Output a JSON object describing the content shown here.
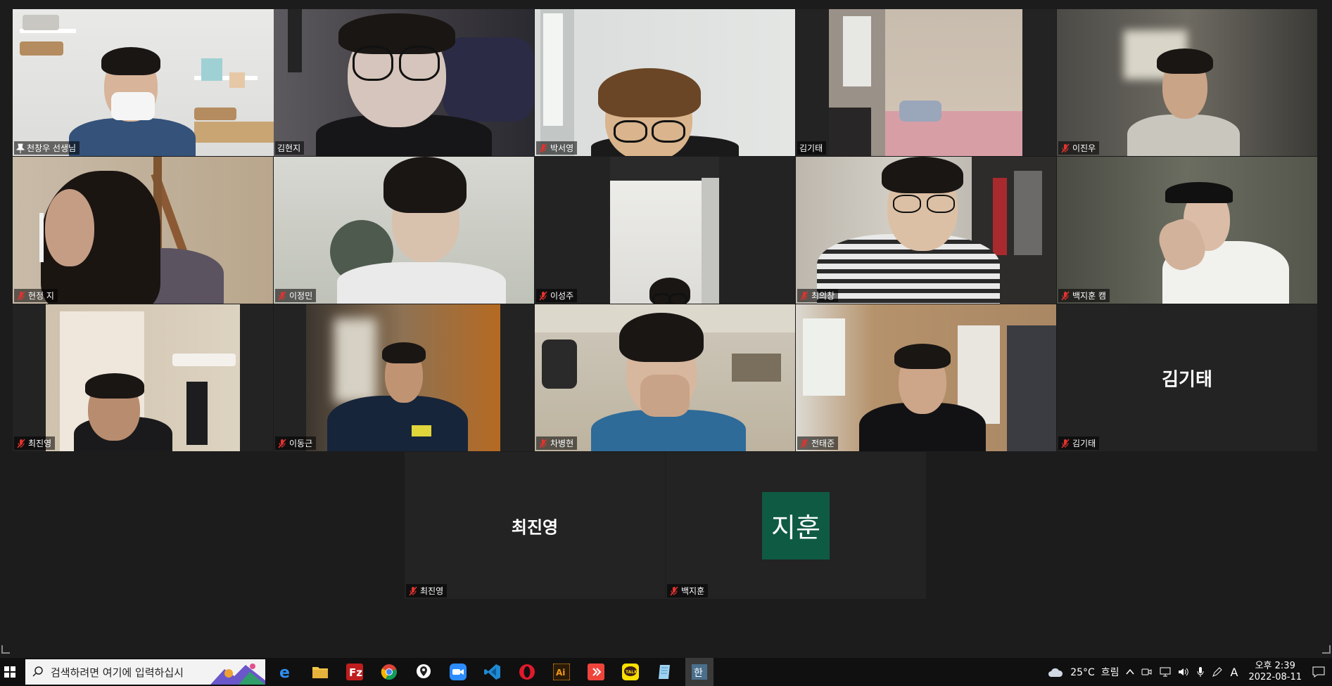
{
  "participants": [
    {
      "name": "천창우 선생님",
      "pinned": true
    },
    {
      "name": "김현지"
    },
    {
      "name": "박서영",
      "muted": true
    },
    {
      "name": "김기태"
    },
    {
      "name": "이진우",
      "muted": true
    },
    {
      "name": "현정 지",
      "muted": true
    },
    {
      "name": "이정민",
      "muted": true
    },
    {
      "name": "이성주",
      "muted": true
    },
    {
      "name": "최의창",
      "muted": true
    },
    {
      "name": "백지훈 캠",
      "muted": true
    },
    {
      "name": "최진영",
      "muted": true
    },
    {
      "name": "이동근",
      "muted": true
    },
    {
      "name": "차병현",
      "muted": true
    },
    {
      "name": "전태준",
      "muted": true
    },
    {
      "name": "김기태",
      "muted": true,
      "video_off_label": "김기태"
    },
    {
      "name": "최진영",
      "muted": true,
      "video_off_label": "최진영"
    },
    {
      "name": "백지훈",
      "muted": true,
      "avatar_text": "지훈"
    }
  ],
  "taskbar": {
    "search_placeholder": "검색하려면 여기에 입력하십시",
    "apps": [
      "internet-explorer",
      "file-explorer",
      "filezilla",
      "chrome",
      "maps",
      "zoom",
      "vscode",
      "opera",
      "illustrator",
      "anydesk",
      "kakaotalk",
      "notepad",
      "korean-ime"
    ],
    "weather": "25°C  흐림",
    "ime": "A",
    "time": "오후 2:39",
    "date": "2022-08-11"
  },
  "colors": {
    "active_speaker": "#c6e04a",
    "avatar_bg": "#0f5a43",
    "mute_icon": "#e0332f"
  }
}
